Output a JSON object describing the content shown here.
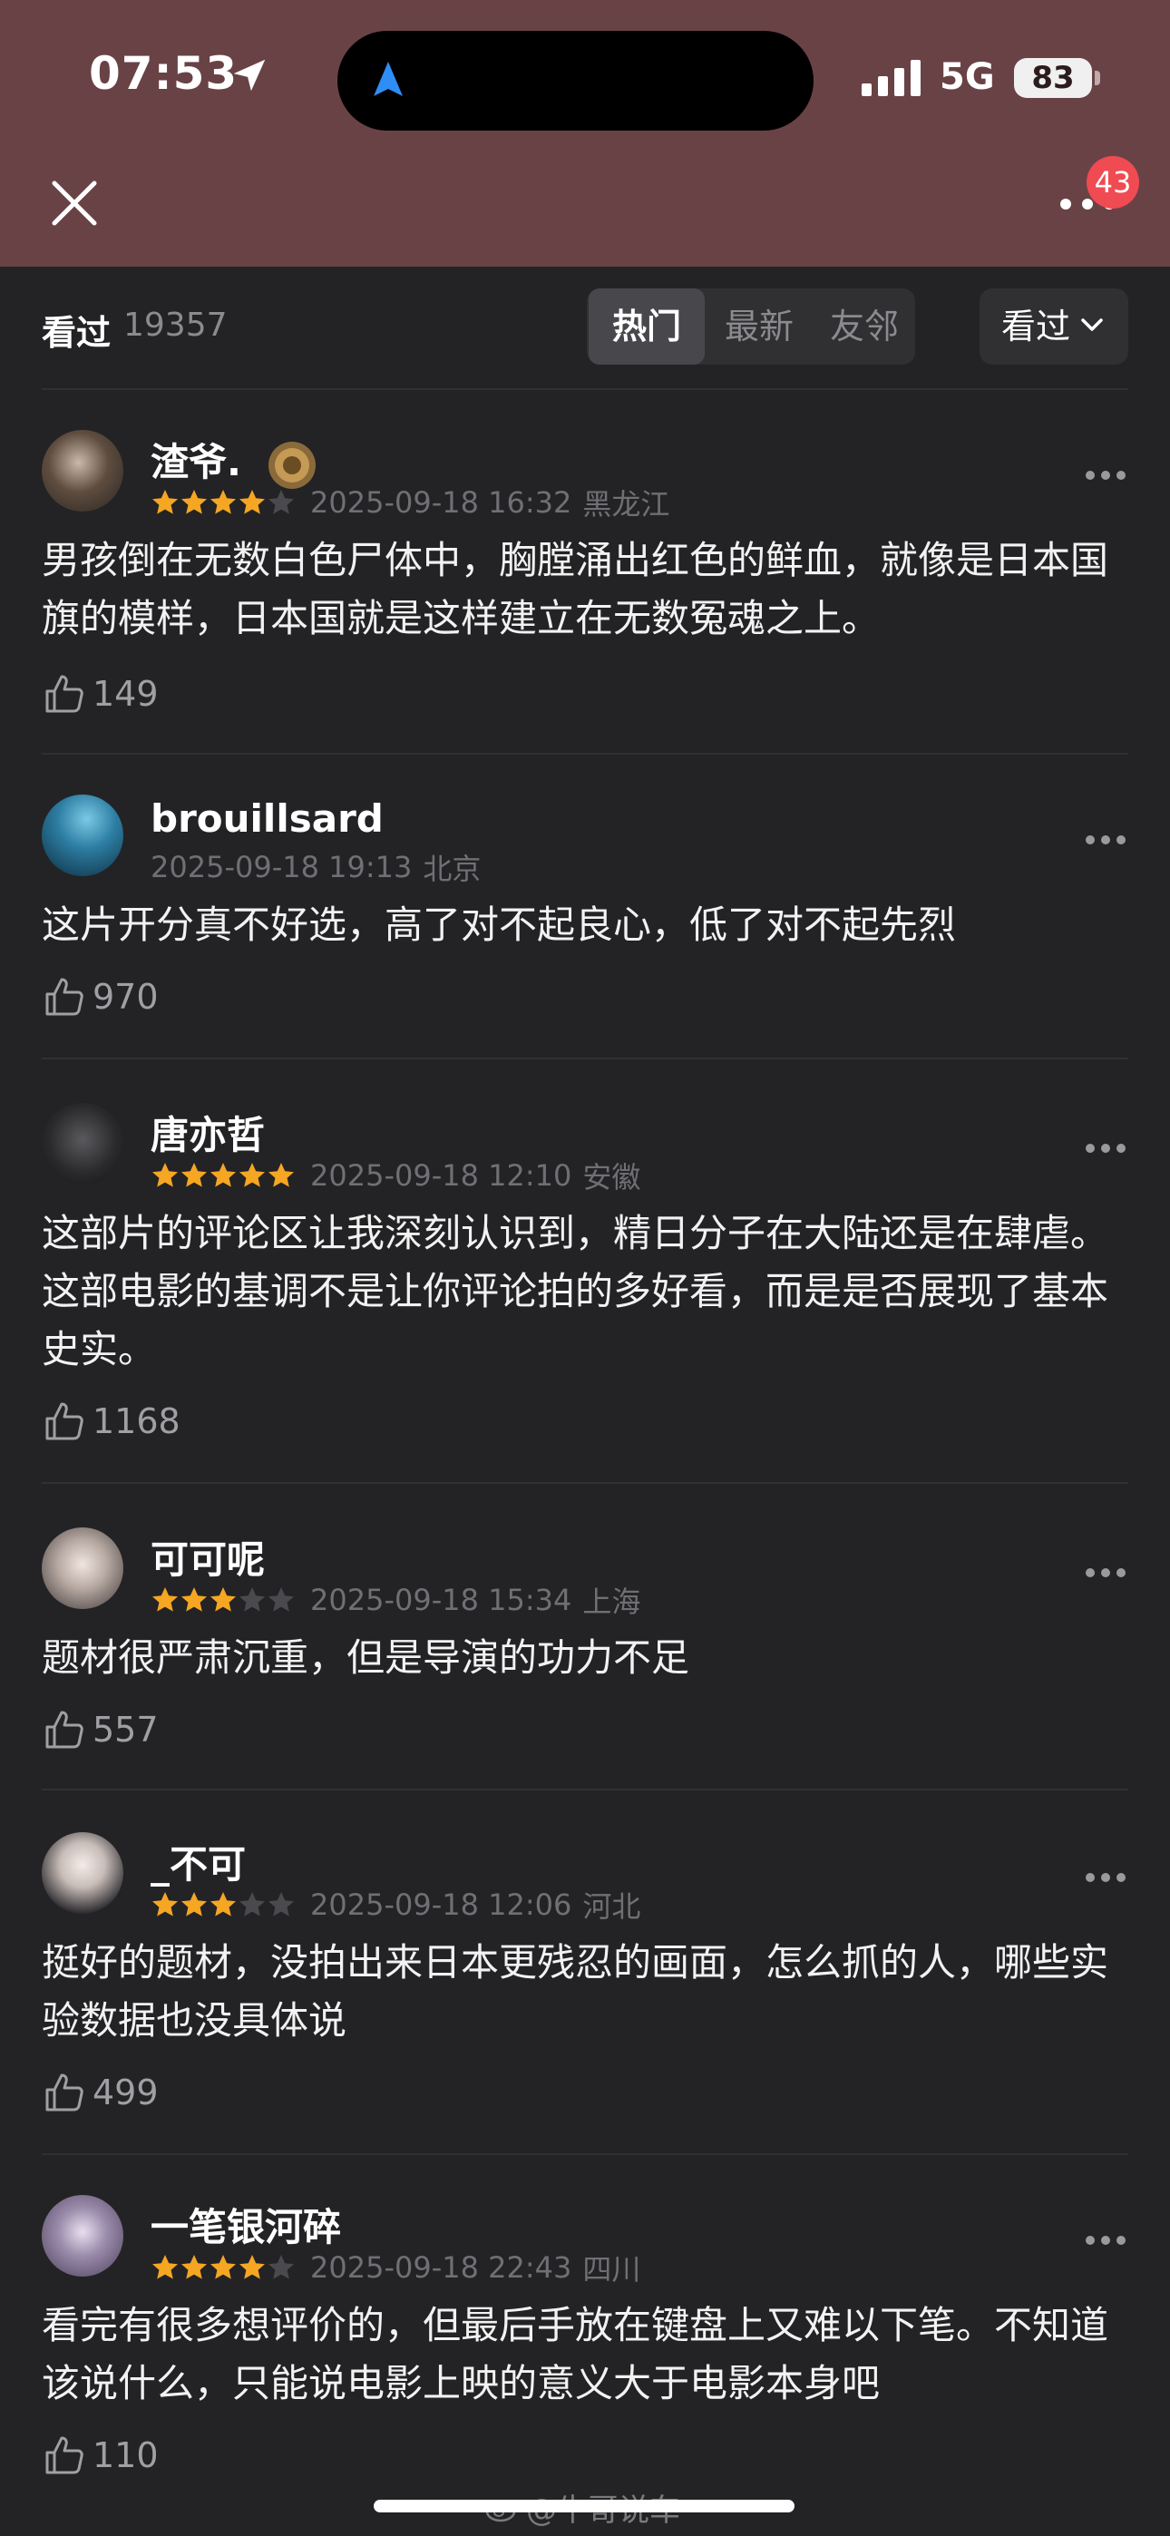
{
  "status_bar": {
    "time": "07:53",
    "network": "5G",
    "battery": "83"
  },
  "header": {
    "badge_count": "43"
  },
  "filter": {
    "seen_label": "看过",
    "seen_count": "19357",
    "tabs": [
      "热门",
      "最新",
      "友邻"
    ],
    "active_tab": "热门",
    "dropdown_label": "看过"
  },
  "comments": [
    {
      "user": "渣爷.",
      "rating": 4,
      "time": "2025-09-18 16:32",
      "location": "黑龙江",
      "text": "男孩倒在无数白色尸体中，胸膛涌出红色的鲜血，就像是日本国旗的模样，日本国就是这样建立在无数冤魂之上。",
      "likes": "149"
    },
    {
      "user": "brouillsard",
      "rating": 0,
      "time": "2025-09-18 19:13",
      "location": "北京",
      "text": "这片开分真不好选，高了对不起良心，低了对不起先烈",
      "likes": "970"
    },
    {
      "user": "唐亦哲",
      "rating": 5,
      "time": "2025-09-18 12:10",
      "location": "安徽",
      "text": "这部片的评论区让我深刻认识到，精日分子在大陆还是在肆虐。这部电影的基调不是让你评论拍的多好看，而是是否展现了基本史实。",
      "likes": "1168"
    },
    {
      "user": "可可呢",
      "rating": 3,
      "time": "2025-09-18 15:34",
      "location": "上海",
      "text": "题材很严肃沉重，但是导演的功力不足",
      "likes": "557"
    },
    {
      "user": "_不可",
      "rating": 3,
      "time": "2025-09-18 12:06",
      "location": "河北",
      "text": "挺好的题材，没拍出来日本更残忍的画面，怎么抓的人，哪些实验数据也没具体说",
      "likes": "499"
    },
    {
      "user": "一笔银河碎",
      "rating": 4,
      "time": "2025-09-18 22:43",
      "location": "四川",
      "text": "看完有很多想评价的，但最后手放在键盘上又难以下笔。不知道该说什么，只能说电影上映的意义大于电影本身吧",
      "likes": "110"
    }
  ],
  "watermark": "@牛哥说车",
  "colors": {
    "header_bg": "#694246",
    "page_bg": "#232325",
    "star": "#f5a623",
    "star_empty": "#4a4a4e",
    "badge": "#f04a52"
  },
  "icons": [
    "location-arrow-icon",
    "close-icon",
    "more-icon",
    "thumbs-up-icon",
    "chevron-down-icon",
    "star-icon"
  ]
}
